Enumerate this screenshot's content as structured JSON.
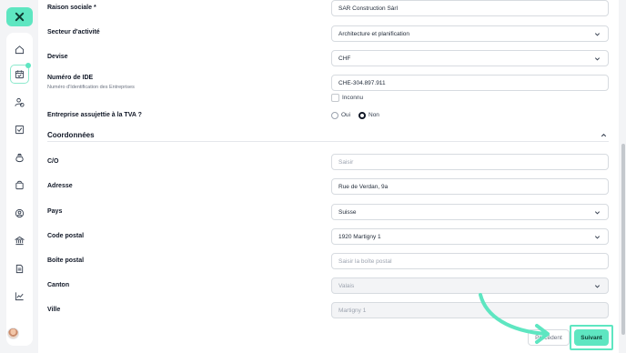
{
  "colors": {
    "accent": "#5ee6c1",
    "border": "#d7dbe0"
  },
  "sidebar": {
    "logo_icon": "brand-logo-icon",
    "items": [
      {
        "icon": "home-icon"
      },
      {
        "icon": "calendar-check-icon",
        "active": true
      },
      {
        "icon": "user-money-icon"
      },
      {
        "icon": "checkbox-icon"
      },
      {
        "icon": "money-bag-icon"
      },
      {
        "icon": "shopping-bag-icon"
      },
      {
        "icon": "user-circle-icon"
      },
      {
        "icon": "bank-icon"
      },
      {
        "icon": "document-icon"
      },
      {
        "icon": "chart-icon"
      }
    ],
    "avatar_icon": "user-avatar"
  },
  "form": {
    "raison_sociale": {
      "label": "Raison sociale *",
      "value": "SAR Construction Sàrl"
    },
    "secteur": {
      "label": "Secteur d'activité",
      "value": "Architecture et planification"
    },
    "devise": {
      "label": "Devise",
      "value": "CHF"
    },
    "ide": {
      "label": "Numéro de IDE",
      "sublabel": "Numéro d'Identification des Entreprises",
      "value": "CHE-304.897.911"
    },
    "inconnu": {
      "label": "Inconnu",
      "checked": false
    },
    "tva": {
      "label": "Entreprise assujettie à la TVA ?",
      "options": [
        "Oui",
        "Non"
      ],
      "selected": "Non"
    }
  },
  "coordonnees": {
    "title": "Coordonnées",
    "co": {
      "label": "C/O",
      "placeholder": "Saisir"
    },
    "adresse": {
      "label": "Adresse",
      "value": "Rue de Verdan, 9a"
    },
    "pays": {
      "label": "Pays",
      "value": "Suisse"
    },
    "code_postal": {
      "label": "Code postal",
      "value": "1920 Martigny 1"
    },
    "boite_postale": {
      "label": "Boîte postal",
      "placeholder": "Saisir la boîte postal"
    },
    "canton": {
      "label": "Canton",
      "value": "Valais"
    },
    "ville": {
      "label": "Ville",
      "value": "Martigny 1"
    }
  },
  "buttons": {
    "previous": "Précédent",
    "next": "Suivant"
  }
}
